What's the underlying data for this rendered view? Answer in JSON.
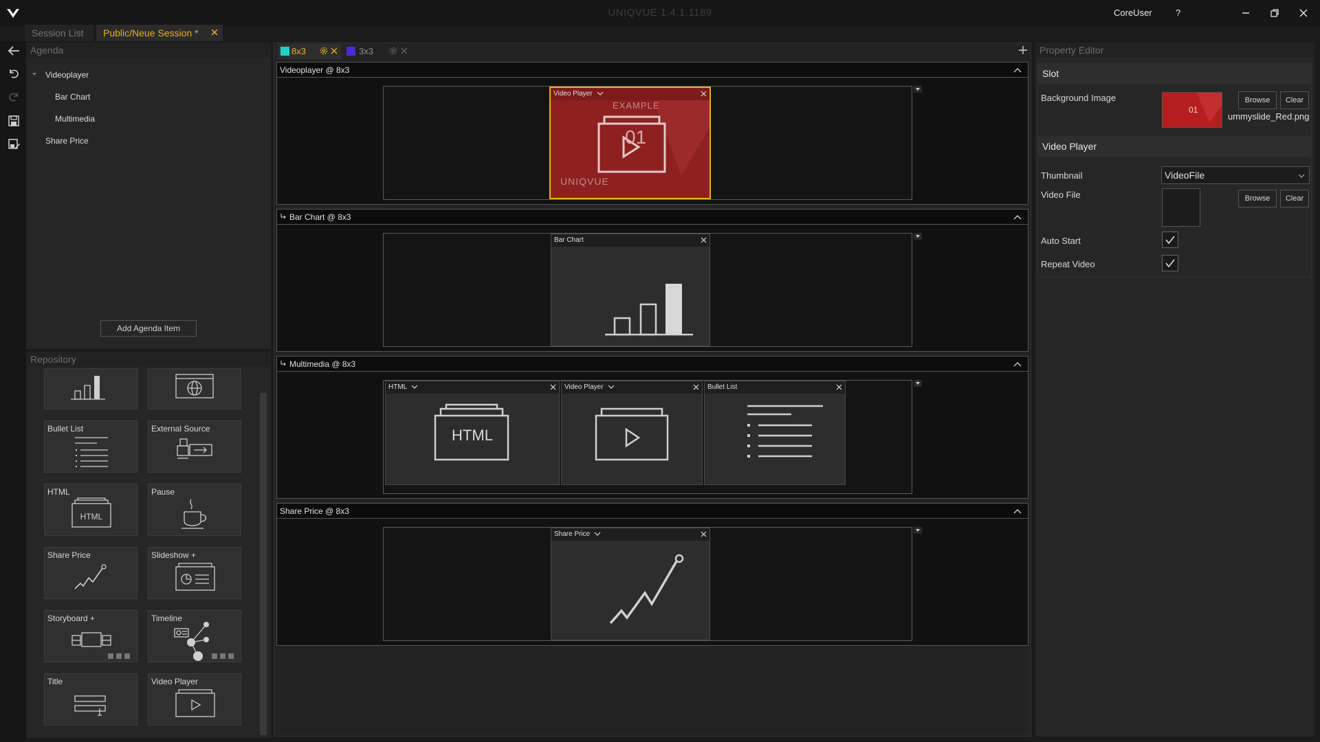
{
  "app": {
    "title": "UNIQVUE 1.4.1.1189",
    "user": "CoreUser",
    "help": "?"
  },
  "session_tabs": {
    "list_label": "Session List",
    "active_label": "Public/Neue Session *"
  },
  "agenda": {
    "title": "Agenda",
    "items": [
      {
        "label": "Videoplayer"
      },
      {
        "label": "Bar Chart"
      },
      {
        "label": "Multimedia"
      },
      {
        "label": "Share Price"
      }
    ],
    "add_button": "Add Agenda Item"
  },
  "repository": {
    "title": "Repository",
    "tiles": [
      {
        "label": "",
        "icon": "bar-chart-icon"
      },
      {
        "label": "",
        "icon": "globe-screen-icon"
      },
      {
        "label": "Bullet List",
        "icon": "bullet-list-icon"
      },
      {
        "label": "External Source",
        "icon": "external-source-icon"
      },
      {
        "label": "HTML",
        "icon": "html-icon"
      },
      {
        "label": "Pause",
        "icon": "coffee-cup-icon"
      },
      {
        "label": "Share Price",
        "icon": "line-chart-icon"
      },
      {
        "label": "Slideshow +",
        "icon": "slideshow-icon"
      },
      {
        "label": "Storyboard +",
        "icon": "storyboard-icon"
      },
      {
        "label": "Timeline",
        "icon": "timeline-icon"
      },
      {
        "label": "Title",
        "icon": "title-icon"
      },
      {
        "label": "Video Player",
        "icon": "video-player-icon"
      }
    ]
  },
  "layout_tabs": [
    {
      "label": "8x3",
      "color": "#1fd1c2"
    },
    {
      "label": "3x3",
      "color": "#4b2bd6"
    }
  ],
  "slides": [
    {
      "title": "Videoplayer @ 8x3",
      "widgets": [
        {
          "label": "Video Player",
          "html_text": ""
        }
      ]
    },
    {
      "title": "Bar Chart @ 8x3",
      "widgets": [
        {
          "label": "Bar Chart"
        }
      ]
    },
    {
      "title": "Multimedia @ 8x3",
      "widgets": [
        {
          "label": "HTML",
          "html_text": "HTML"
        },
        {
          "label": "Video Player"
        },
        {
          "label": "Bullet List"
        }
      ]
    },
    {
      "title": "Share Price @ 8x3",
      "widgets": [
        {
          "label": "Share Price"
        }
      ]
    }
  ],
  "video_preview": {
    "top_text": "EXAMPLE",
    "number": "01",
    "brand": "UNIQVUE"
  },
  "property_editor": {
    "title": "Property Editor",
    "slot_section": "Slot",
    "background_image_label": "Background Image",
    "background_image_file": "ummyslide_Red.png",
    "thumb_number": "01",
    "browse": "Browse",
    "clear": "Clear",
    "video_section": "Video Player",
    "thumbnail_label": "Thumbnail",
    "thumbnail_value": "VideoFile",
    "video_file_label": "Video File",
    "auto_start_label": "Auto Start",
    "auto_start": true,
    "repeat_label": "Repeat Video",
    "repeat": true
  }
}
